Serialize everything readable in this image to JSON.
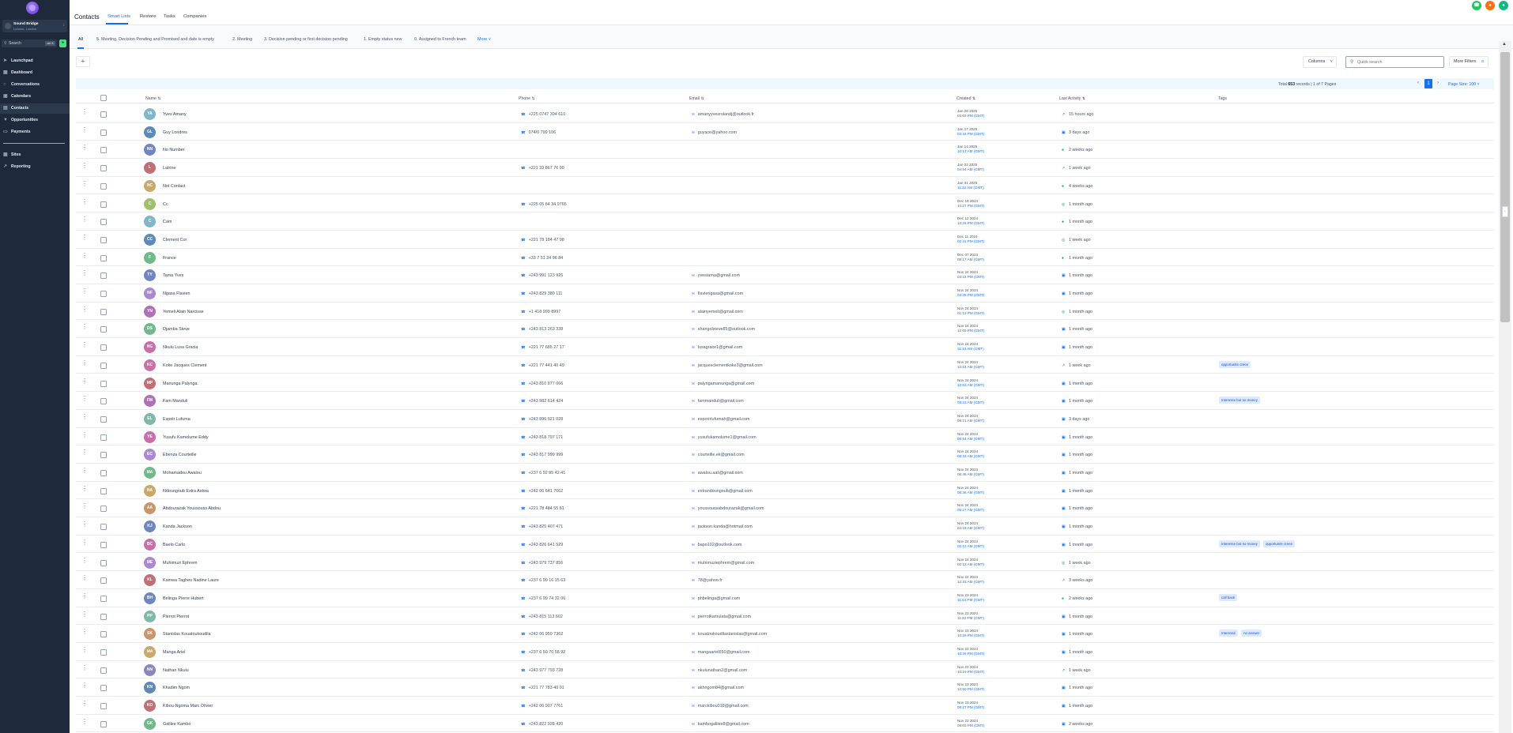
{
  "sidebar": {
    "account": {
      "name": "Sound Bridge",
      "location": "London, London"
    },
    "search": {
      "placeholder": "Search",
      "shortcut": "ctrl K"
    },
    "items": [
      {
        "label": "Launchpad",
        "icon": "rocket-icon"
      },
      {
        "label": "Dashboard",
        "icon": "dashboard-icon"
      },
      {
        "label": "Conversations",
        "icon": "chat-icon"
      },
      {
        "label": "Calendars",
        "icon": "calendar-icon"
      },
      {
        "label": "Contacts",
        "icon": "contacts-icon",
        "active": true
      },
      {
        "label": "Opportunities",
        "icon": "funnel-icon"
      },
      {
        "label": "Payments",
        "icon": "payments-icon"
      },
      {
        "label": "Sites",
        "icon": "sites-icon"
      },
      {
        "label": "Reporting",
        "icon": "reporting-icon"
      }
    ]
  },
  "header": {
    "title": "Contacts",
    "tabs": [
      "Smart Lists",
      "Restore",
      "Tasks",
      "Companies"
    ]
  },
  "smart_lists": {
    "tabs": [
      "All",
      "5. Meeting, Decision Pending and Promised and date is empty",
      "2. Meeting",
      "3. Decision pending or first decision pending",
      "1. Empty status new",
      "0. Assigned to French team"
    ],
    "more": "More"
  },
  "toolbar": {
    "add": "+",
    "columns": "Columns",
    "quick_search_placeholder": "Quick search",
    "more_filters": "More Filters"
  },
  "pagination": {
    "total_prefix": "Total",
    "total": "653",
    "total_suffix": "records | 1 of 7 Pages",
    "current_page": "1",
    "page_size": "Page Size: 100"
  },
  "columns": {
    "name": "Name",
    "phone": "Phone",
    "email": "Email",
    "created": "Created",
    "last_activity": "Last Activity",
    "tags": "Tags"
  },
  "colors": {
    "accent": "#1570ef",
    "sidebar": "#1e2a3b"
  },
  "rows": [
    {
      "initials": "YA",
      "color": "#7fb7c9",
      "name": "Yves Amany",
      "phone": "+225 0747 394 610",
      "email": "amanyyvesrolandj@outlook.fr",
      "date": "Jan 20 2025",
      "time": "03:03 PM (GMT)",
      "activity": "15 hours ago",
      "icon": "call",
      "tags": []
    },
    {
      "initials": "GL",
      "color": "#5d8ab8",
      "name": "Guy Londres",
      "phone": "074/0 799 106",
      "email": "guyace@yahoo.com",
      "date": "Jan 17 2025",
      "time": "03:34 PM (GMT)",
      "activity": "3 days ago",
      "icon": "msg",
      "tags": []
    },
    {
      "initials": "NN",
      "color": "#6f86c0",
      "name": "No Number",
      "phone": "",
      "email": "",
      "date": "Jan 14 2025",
      "time": "10:13 AM (GMT)",
      "activity": "2 weeks ago",
      "icon": "sms",
      "tags": []
    },
    {
      "initials": "L",
      "color": "#c06f75",
      "name": "Latrine",
      "phone": "+221 33 867 76 00",
      "email": "",
      "date": "Jan 02 2025",
      "time": "04:54 AM (GMT)",
      "activity": "1 week ago",
      "icon": "call",
      "tags": []
    },
    {
      "initials": "NC",
      "color": "#c9a86a",
      "name": "Not Contact",
      "phone": "",
      "email": "",
      "date": "Jan 01 2025",
      "time": "11:32 AM (GMT)",
      "activity": "4 weeks ago",
      "icon": "sms",
      "tags": []
    },
    {
      "initials": "C",
      "color": "#9fc06b",
      "name": "Cc",
      "phone": "+225 05 64 34 9765",
      "email": "",
      "date": "Dec 18 2024",
      "time": "10:27 PM (GMT)",
      "activity": "1 month ago",
      "icon": "wa",
      "tags": []
    },
    {
      "initials": "C",
      "color": "#7fb7c9",
      "name": "Cam",
      "phone": "",
      "email": "",
      "date": "Dec 12 2024",
      "time": "12:26 PM (GMT)",
      "activity": "1 month ago",
      "icon": "sms",
      "tags": []
    },
    {
      "initials": "CC",
      "color": "#5d8ab8",
      "name": "Clement Cor",
      "phone": "+221 78 184 47 98",
      "email": "",
      "date": "Dec 11 2024",
      "time": "02:41 PM (GMT)",
      "activity": "1 week ago",
      "icon": "wa",
      "tags": []
    },
    {
      "initials": "F",
      "color": "#6fb98a",
      "name": "France",
      "phone": "+33 7 51 24 96 84",
      "email": "",
      "date": "Dec 07 2024",
      "time": "09:17 AM (GMT)",
      "activity": "1 month ago",
      "icon": "sms",
      "tags": []
    },
    {
      "initials": "TY",
      "color": "#6f86c0",
      "name": "Tama Yves",
      "phone": "+243 991 123 926",
      "email": "yvestama@gmail.com",
      "date": "Nov 24 2024",
      "time": "03:22 PM (GMT)",
      "activity": "1 month ago",
      "icon": "msg",
      "tags": []
    },
    {
      "initials": "NF",
      "color": "#a98ad0",
      "name": "Ngasa Flavien",
      "phone": "+243 829 389 111",
      "email": "flaviengasa@gmail.com",
      "date": "Nov 24 2024",
      "time": "03:38 PM (GMT)",
      "activity": "1 month ago",
      "icon": "msg",
      "tags": []
    },
    {
      "initials": "YN",
      "color": "#b070b8",
      "name": "Yemeli Alain Narcisse",
      "phone": "+1 418 999 8997",
      "email": "alainyemeli@gmail.com",
      "date": "Nov 24 2024",
      "time": "01:13 PM (GMT)",
      "activity": "1 month ago",
      "icon": "wa",
      "tags": []
    },
    {
      "initials": "DS",
      "color": "#6fb98a",
      "name": "Djamba Steve",
      "phone": "+243 813 263 338",
      "email": "shangolsteve85@outlook.com",
      "date": "Nov 24 2024",
      "time": "12:05 PM (GMT)",
      "activity": "1 month ago",
      "icon": "msg",
      "tags": []
    },
    {
      "initials": "NG",
      "color": "#c96fa8",
      "name": "Nkulu Lusa Gracia",
      "phone": "+221 77 685 27 17",
      "email": "lusagrace1@gmail.com",
      "date": "Nov 24 2024",
      "time": "11:13 AM (GMT)",
      "activity": "1 month ago",
      "icon": "msg",
      "tags": []
    },
    {
      "initials": "KC",
      "color": "#c96fa8",
      "name": "Koke Jacques Clement",
      "phone": "+221 77 441 40 49",
      "email": "jacquesclementkoke3@gmail.com",
      "date": "Nov 24 2024",
      "time": "10:54 AM (GMT)",
      "activity": "1 week ago",
      "icon": "call",
      "tags": [
        "opportunite creee"
      ]
    },
    {
      "initials": "MP",
      "color": "#c06f75",
      "name": "Manunga Palynga",
      "phone": "+243 810 877 066",
      "email": "palyngamanunga@gmail.com",
      "date": "Nov 24 2024",
      "time": "10:53 AM (GMT)",
      "activity": "1 month ago",
      "icon": "msg",
      "tags": []
    },
    {
      "initials": "FM",
      "color": "#b070b8",
      "name": "Fam Manduli",
      "phone": "+243 982 614 424",
      "email": "fammanduli@gmail.com",
      "date": "Nov 24 2024",
      "time": "09:23 AM (GMT)",
      "activity": "1 month ago",
      "icon": "msg",
      "tags": [
        "Interesse but no money"
      ]
    },
    {
      "initials": "EL",
      "color": "#7fb7a9",
      "name": "Espoir Lufuma",
      "phone": "+243 896 921 028",
      "email": "esporirlufumah@gmail.com",
      "date": "Nov 24 2024",
      "time": "09:21 AM (GMT)",
      "activity": "3 days ago",
      "icon": "msg",
      "tags": []
    },
    {
      "initials": "YE",
      "color": "#c96fa8",
      "name": "Yusufu Kamolume Eddy",
      "phone": "+243 818 797 171",
      "email": "yusufukamolume1@gmail.com",
      "date": "Nov 24 2024",
      "time": "08:54 AM (GMT)",
      "activity": "1 month ago",
      "icon": "msg",
      "tags": []
    },
    {
      "initials": "EC",
      "color": "#a98ad0",
      "name": "Ebenza Courteille",
      "phone": "+243 817 999 999",
      "email": "courteille.ek@gmail.com",
      "date": "Nov 24 2024",
      "time": "08:32 AM (GMT)",
      "activity": "1 month ago",
      "icon": "msg",
      "tags": []
    },
    {
      "initials": "MA",
      "color": "#6fb98a",
      "name": "Mohamadou Awalou",
      "phone": "+237 6 92 95 42 41",
      "email": "awalou.aali@gmail.com",
      "date": "Nov 24 2024",
      "time": "06:48 AM (GMT)",
      "activity": "1 month ago",
      "icon": "msg",
      "tags": []
    },
    {
      "initials": "NA",
      "color": "#c9a86a",
      "name": "Ndoungoub Extra Astwa",
      "phone": "+242 06 641 7662",
      "email": "extrandoungoub@gmail.com",
      "date": "Nov 24 2024",
      "time": "06:36 AM (GMT)",
      "activity": "1 month ago",
      "icon": "msg",
      "tags": []
    },
    {
      "initials": "AA",
      "color": "#c9956a",
      "name": "Abdourazak Youssouss Abdou",
      "phone": "+221 78 484 55 61",
      "email": "youssoussabdourazak@gmail.com",
      "date": "Nov 24 2024",
      "time": "05:27 AM (GMT)",
      "activity": "1 month ago",
      "icon": "msg",
      "tags": []
    },
    {
      "initials": "KJ",
      "color": "#6f86c0",
      "name": "Kanda Jackson",
      "phone": "+243 825 407 471",
      "email": "jackson.kanda@hotmail.com",
      "date": "Nov 24 2024",
      "time": "04:18 AM (GMT)",
      "activity": "1 month ago",
      "icon": "msg",
      "tags": []
    },
    {
      "initials": "BC",
      "color": "#c96fa8",
      "name": "Baelo Carlo",
      "phone": "+243 826 641 529",
      "email": "bapo102@outlook.com",
      "date": "Nov 24 2024",
      "time": "02:12 AM (GMT)",
      "activity": "1 month ago",
      "icon": "msg",
      "tags": [
        "Interesse but no money",
        "opportunite creee"
      ]
    },
    {
      "initials": "ME",
      "color": "#a98ad0",
      "name": "Muhimuzi Ephrem",
      "phone": "+243 979 737 856",
      "email": "muhimuziephrem@gmail.com",
      "date": "Nov 24 2024",
      "time": "02:12 AM (GMT)",
      "activity": "1 week ago",
      "icon": "wa",
      "tags": []
    },
    {
      "initials": "KL",
      "color": "#c06f75",
      "name": "Kamwa Tagheu Nadine Laure",
      "phone": "+237 6 99 16 15 63",
      "email": "78@yahoo.fr",
      "date": "Nov 24 2024",
      "time": "12:33 AM (GMT)",
      "activity": "3 weeks ago",
      "icon": "call",
      "tags": []
    },
    {
      "initials": "BH",
      "color": "#6f86c0",
      "name": "Belinga Pierre Hubert",
      "phone": "+237 6 99 74 32 06",
      "email": "phbelinga@gmail.com",
      "date": "Nov 23 2024",
      "time": "11:54 PM (GMT)",
      "activity": "2 weeks ago",
      "icon": "sms",
      "tags": [
        "call back"
      ]
    },
    {
      "initials": "PP",
      "color": "#7fb7a9",
      "name": "Pierrot Pierrot",
      "phone": "+243 815 113 602",
      "email": "pierrotkamulata@gmail.com",
      "date": "Nov 23 2024",
      "time": "11:32 PM (GMT)",
      "activity": "1 month ago",
      "icon": "msg",
      "tags": []
    },
    {
      "initials": "SK",
      "color": "#c9956a",
      "name": "Stanislas Kouatoukoudila",
      "phone": "+242 06 959 7362",
      "email": "kouatoukoudilastanislas@gmail.com",
      "date": "Nov 23 2024",
      "time": "10:28 PM (GMT)",
      "activity": "1 month ago",
      "icon": "msg",
      "tags": [
        "Interessé",
        "no answer"
      ]
    },
    {
      "initials": "MA",
      "color": "#c9a86a",
      "name": "Manga Ariel",
      "phone": "+237 6 50 70 58 92",
      "email": "mangaariel650@gmail.com",
      "date": "Nov 23 2024",
      "time": "10:26 PM (GMT)",
      "activity": "1 month ago",
      "icon": "msg",
      "tags": []
    },
    {
      "initials": "NN",
      "color": "#8a84c0",
      "name": "Nathan Nkulu",
      "phone": "+243 977 793 728",
      "email": "nkulunathan2@gmail.com",
      "date": "Nov 23 2024",
      "time": "10:16 PM (GMT)",
      "activity": "1 week ago",
      "icon": "call",
      "tags": []
    },
    {
      "initials": "KN",
      "color": "#5d8ab8",
      "name": "Khadim Ngom",
      "phone": "+221 77 783 40 01",
      "email": "akhngom84@gmail.com",
      "date": "Nov 23 2024",
      "time": "10:50 PM (GMT)",
      "activity": "1 month ago",
      "icon": "msg",
      "tags": []
    },
    {
      "initials": "KO",
      "color": "#c06f75",
      "name": "Kibou-Ngoma Marc Olivier",
      "phone": "+242 06 907 7761",
      "email": "marckibou018@gmail.com",
      "date": "Nov 23 2024",
      "time": "09:17 PM (GMT)",
      "activity": "1 month ago",
      "icon": "msg",
      "tags": []
    },
    {
      "initials": "GK",
      "color": "#6fb98a",
      "name": "Galilee Kambo",
      "phone": "+243 822 928 420",
      "email": "kambogalilee8@gmail.com",
      "date": "Nov 23 2024",
      "time": "09:03 PM (GMT)",
      "activity": "2 weeks ago",
      "icon": "msg",
      "tags": []
    }
  ]
}
